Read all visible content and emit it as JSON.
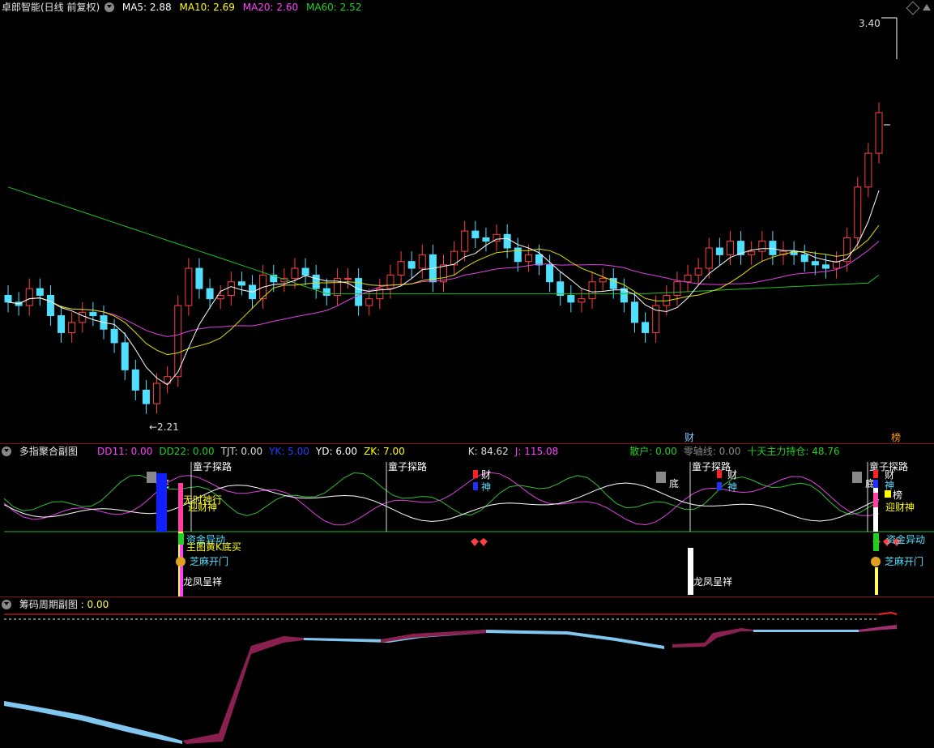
{
  "main": {
    "title": "卓郎智能(日线 前复权)",
    "ma": [
      {
        "label": "MA5:",
        "value": "2.88",
        "color": "#ffffff"
      },
      {
        "label": "MA10:",
        "value": "2.69",
        "color": "#ffff00"
      },
      {
        "label": "MA20:",
        "value": "2.60",
        "color": "#ff40ff"
      },
      {
        "label": "MA60:",
        "value": "2.52",
        "color": "#20d020"
      }
    ],
    "high_label": "3.40",
    "low_label": "←2.21",
    "markers": [
      "财",
      "榜"
    ]
  },
  "sub1": {
    "title": "多指聚合副图",
    "stats": [
      {
        "label": "DD11:",
        "value": "0.00",
        "color": "#ff40ff"
      },
      {
        "label": "DD22:",
        "value": "0.00",
        "color": "#20d020"
      },
      {
        "label": "TJT:",
        "value": "0.00",
        "color": "#dddddd"
      },
      {
        "label": "YK:",
        "value": "5.00",
        "color": "#2040ff"
      },
      {
        "label": "YD:",
        "value": "6.00",
        "color": "#ffffff"
      },
      {
        "label": "ZK:",
        "value": "7.00",
        "color": "#ffff00"
      },
      {
        "label": "K:",
        "value": "84.62",
        "color": "#dddddd"
      },
      {
        "label": "J:",
        "value": "115.08",
        "color": "#ff40ff"
      },
      {
        "label": "散户:",
        "value": "0.00",
        "color": "#20d020"
      },
      {
        "label": "零轴线:",
        "value": "0.00",
        "color": "#888888"
      },
      {
        "label": "十天主力持仓:",
        "value": "48.76",
        "color": "#20d020"
      }
    ],
    "signals": {
      "tongzi": "童子探路",
      "di": "底",
      "cai": "财",
      "shen": "神",
      "yingcaishen": "迎财神",
      "zijin": "资金异动",
      "zhutu": "主图黄K底买",
      "zhima": "芝麻开门",
      "longfeng": "龙凤呈祥",
      "bang": "榜",
      "wuji": "无时神行"
    }
  },
  "sub2": {
    "title": "筹码周期副图",
    "value": ": 0.00"
  }
}
